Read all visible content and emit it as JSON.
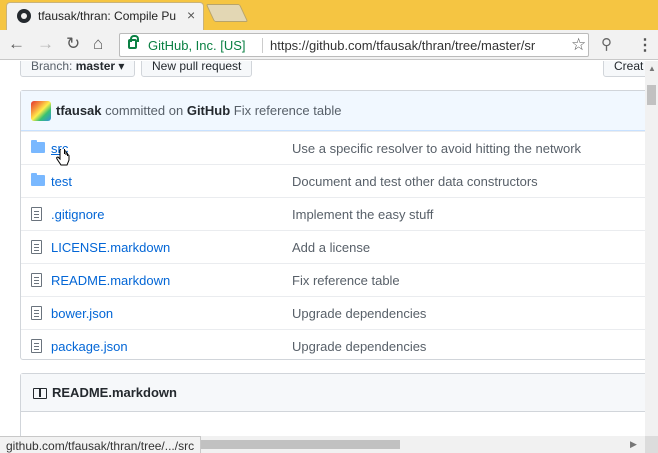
{
  "browser": {
    "tab_title": "tfausak/thran: Compile Pu",
    "tab_close": "×",
    "security_label": "GitHub, Inc. [US]",
    "url": "https://github.com/tfausak/thran/tree/master/sr",
    "status_url": "github.com/tfausak/thran/tree/.../src"
  },
  "repo": {
    "branch_label": "Branch:",
    "branch_name": "master",
    "new_pull_request": "New pull request",
    "create_button": "Creat"
  },
  "commit": {
    "author": "tfausak",
    "verb": "committed on",
    "via": "GitHub",
    "message": "Fix reference table"
  },
  "files": [
    {
      "type": "folder",
      "name": "src",
      "message": "Use a specific resolver to avoid hitting the network"
    },
    {
      "type": "folder",
      "name": "test",
      "message": "Document and test other data constructors"
    },
    {
      "type": "file",
      "name": ".gitignore",
      "message": "Implement the easy stuff"
    },
    {
      "type": "file",
      "name": "LICENSE.markdown",
      "message": "Add a license"
    },
    {
      "type": "file",
      "name": "README.markdown",
      "message": "Fix reference table"
    },
    {
      "type": "file",
      "name": "bower.json",
      "message": "Upgrade dependencies"
    },
    {
      "type": "file",
      "name": "package.json",
      "message": "Upgrade dependencies"
    }
  ],
  "readme": {
    "title": "README.markdown"
  }
}
